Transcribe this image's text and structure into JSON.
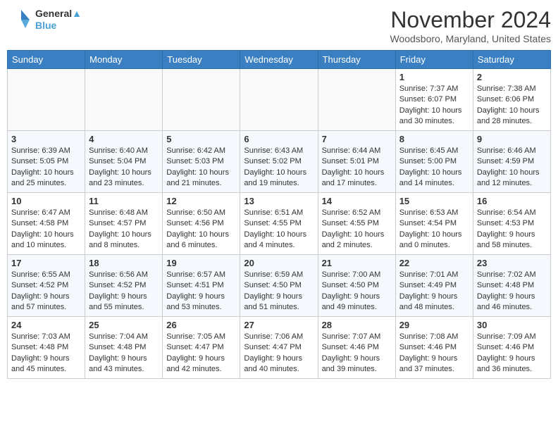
{
  "header": {
    "logo_line1": "General",
    "logo_line2": "Blue",
    "month": "November 2024",
    "location": "Woodsboro, Maryland, United States"
  },
  "days_of_week": [
    "Sunday",
    "Monday",
    "Tuesday",
    "Wednesday",
    "Thursday",
    "Friday",
    "Saturday"
  ],
  "weeks": [
    [
      {
        "day": "",
        "info": ""
      },
      {
        "day": "",
        "info": ""
      },
      {
        "day": "",
        "info": ""
      },
      {
        "day": "",
        "info": ""
      },
      {
        "day": "",
        "info": ""
      },
      {
        "day": "1",
        "info": "Sunrise: 7:37 AM\nSunset: 6:07 PM\nDaylight: 10 hours and 30 minutes."
      },
      {
        "day": "2",
        "info": "Sunrise: 7:38 AM\nSunset: 6:06 PM\nDaylight: 10 hours and 28 minutes."
      }
    ],
    [
      {
        "day": "3",
        "info": "Sunrise: 6:39 AM\nSunset: 5:05 PM\nDaylight: 10 hours and 25 minutes."
      },
      {
        "day": "4",
        "info": "Sunrise: 6:40 AM\nSunset: 5:04 PM\nDaylight: 10 hours and 23 minutes."
      },
      {
        "day": "5",
        "info": "Sunrise: 6:42 AM\nSunset: 5:03 PM\nDaylight: 10 hours and 21 minutes."
      },
      {
        "day": "6",
        "info": "Sunrise: 6:43 AM\nSunset: 5:02 PM\nDaylight: 10 hours and 19 minutes."
      },
      {
        "day": "7",
        "info": "Sunrise: 6:44 AM\nSunset: 5:01 PM\nDaylight: 10 hours and 17 minutes."
      },
      {
        "day": "8",
        "info": "Sunrise: 6:45 AM\nSunset: 5:00 PM\nDaylight: 10 hours and 14 minutes."
      },
      {
        "day": "9",
        "info": "Sunrise: 6:46 AM\nSunset: 4:59 PM\nDaylight: 10 hours and 12 minutes."
      }
    ],
    [
      {
        "day": "10",
        "info": "Sunrise: 6:47 AM\nSunset: 4:58 PM\nDaylight: 10 hours and 10 minutes."
      },
      {
        "day": "11",
        "info": "Sunrise: 6:48 AM\nSunset: 4:57 PM\nDaylight: 10 hours and 8 minutes."
      },
      {
        "day": "12",
        "info": "Sunrise: 6:50 AM\nSunset: 4:56 PM\nDaylight: 10 hours and 6 minutes."
      },
      {
        "day": "13",
        "info": "Sunrise: 6:51 AM\nSunset: 4:55 PM\nDaylight: 10 hours and 4 minutes."
      },
      {
        "day": "14",
        "info": "Sunrise: 6:52 AM\nSunset: 4:55 PM\nDaylight: 10 hours and 2 minutes."
      },
      {
        "day": "15",
        "info": "Sunrise: 6:53 AM\nSunset: 4:54 PM\nDaylight: 10 hours and 0 minutes."
      },
      {
        "day": "16",
        "info": "Sunrise: 6:54 AM\nSunset: 4:53 PM\nDaylight: 9 hours and 58 minutes."
      }
    ],
    [
      {
        "day": "17",
        "info": "Sunrise: 6:55 AM\nSunset: 4:52 PM\nDaylight: 9 hours and 57 minutes."
      },
      {
        "day": "18",
        "info": "Sunrise: 6:56 AM\nSunset: 4:52 PM\nDaylight: 9 hours and 55 minutes."
      },
      {
        "day": "19",
        "info": "Sunrise: 6:57 AM\nSunset: 4:51 PM\nDaylight: 9 hours and 53 minutes."
      },
      {
        "day": "20",
        "info": "Sunrise: 6:59 AM\nSunset: 4:50 PM\nDaylight: 9 hours and 51 minutes."
      },
      {
        "day": "21",
        "info": "Sunrise: 7:00 AM\nSunset: 4:50 PM\nDaylight: 9 hours and 49 minutes."
      },
      {
        "day": "22",
        "info": "Sunrise: 7:01 AM\nSunset: 4:49 PM\nDaylight: 9 hours and 48 minutes."
      },
      {
        "day": "23",
        "info": "Sunrise: 7:02 AM\nSunset: 4:48 PM\nDaylight: 9 hours and 46 minutes."
      }
    ],
    [
      {
        "day": "24",
        "info": "Sunrise: 7:03 AM\nSunset: 4:48 PM\nDaylight: 9 hours and 45 minutes."
      },
      {
        "day": "25",
        "info": "Sunrise: 7:04 AM\nSunset: 4:48 PM\nDaylight: 9 hours and 43 minutes."
      },
      {
        "day": "26",
        "info": "Sunrise: 7:05 AM\nSunset: 4:47 PM\nDaylight: 9 hours and 42 minutes."
      },
      {
        "day": "27",
        "info": "Sunrise: 7:06 AM\nSunset: 4:47 PM\nDaylight: 9 hours and 40 minutes."
      },
      {
        "day": "28",
        "info": "Sunrise: 7:07 AM\nSunset: 4:46 PM\nDaylight: 9 hours and 39 minutes."
      },
      {
        "day": "29",
        "info": "Sunrise: 7:08 AM\nSunset: 4:46 PM\nDaylight: 9 hours and 37 minutes."
      },
      {
        "day": "30",
        "info": "Sunrise: 7:09 AM\nSunset: 4:46 PM\nDaylight: 9 hours and 36 minutes."
      }
    ]
  ]
}
